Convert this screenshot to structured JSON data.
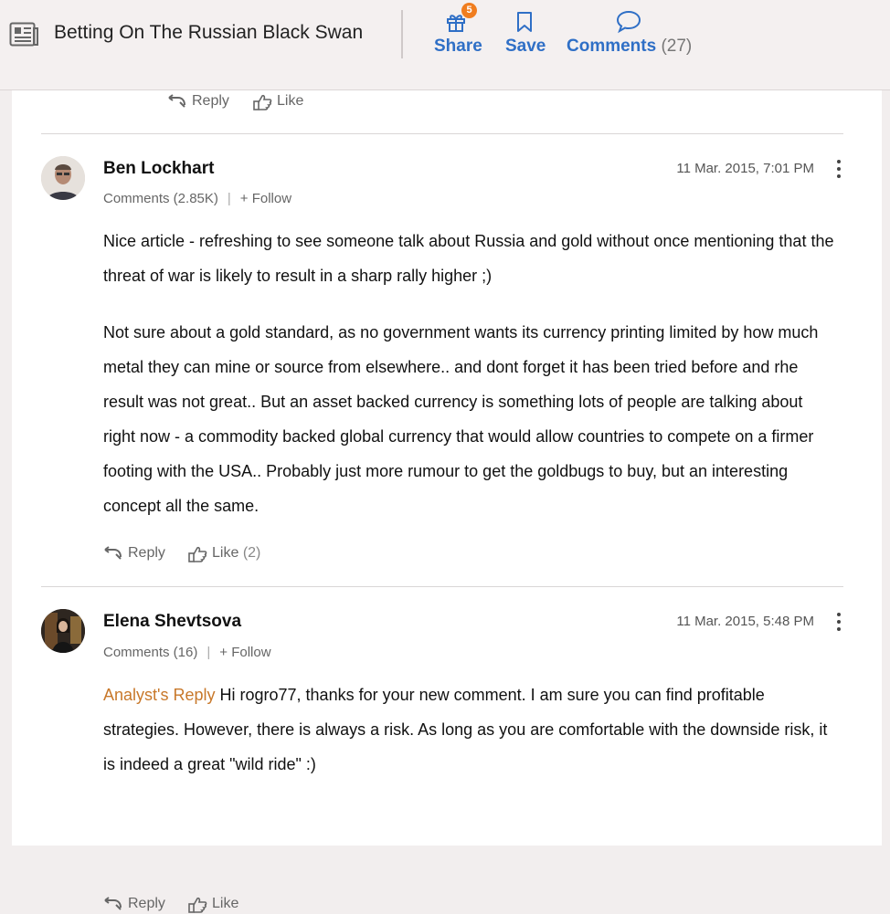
{
  "header": {
    "article_title": "Betting On The Russian Black Swan",
    "share_label": "Share",
    "share_badge": "5",
    "save_label": "Save",
    "comments_label": "Comments",
    "comments_count": "(27)"
  },
  "top_actions": {
    "reply_label": "Reply",
    "like_label": "Like"
  },
  "comments": [
    {
      "author": "Ben Lockhart",
      "comments_count": "Comments (2.85K)",
      "separator": "|",
      "follow_label": "+ Follow",
      "timestamp": "11 Mar. 2015, 7:01 PM",
      "paragraphs": [
        "Nice article - refreshing to see someone talk about Russia and gold without once mentioning that the threat of war is likely to result in a sharp rally higher ;)",
        "Not sure about a gold standard, as no government wants its currency printing limited by how much metal they can mine or source from elsewhere.. and dont forget it has been tried before and rhe result was not great.. But an asset backed currency is something lots of people are talking about right now - a commodity backed global currency that would allow countries to compete on a firmer footing with the USA.. Probably just more rumour to get the goldbugs to buy, but an interesting concept all the same."
      ],
      "reply_label": "Reply",
      "like_label": "Like",
      "like_count": "(2)"
    },
    {
      "author": "Elena Shevtsova",
      "comments_count": "Comments (16)",
      "separator": "|",
      "follow_label": "+ Follow",
      "timestamp": "11 Mar. 2015, 5:48 PM",
      "analyst_tag": "Analyst's Reply",
      "text": "Hi rogro77, thanks for your new comment. I am sure you can find profitable strategies. However, there is always a risk. As long as you are comfortable with the downside risk, it is indeed a great \"wild ride\" :)",
      "reply_label": "Reply",
      "like_label": "Like"
    }
  ],
  "colors": {
    "link_blue": "#2f6fc6",
    "badge_orange": "#f07d1f",
    "analyst_orange": "#c8782a"
  }
}
